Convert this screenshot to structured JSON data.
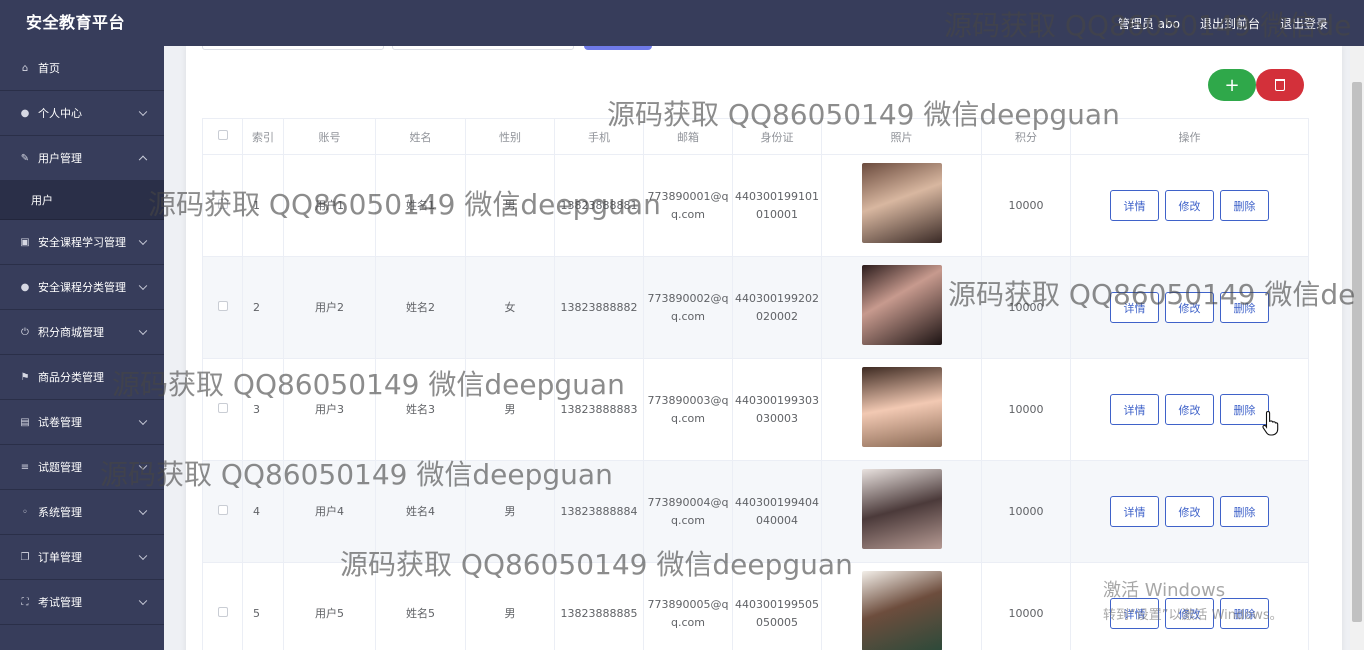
{
  "header": {
    "brand": "安全教育平台",
    "user_label": "管理员 abo",
    "frontend_link": "退出到前台",
    "logout_link": "退出登录"
  },
  "sidebar": {
    "items": [
      {
        "label": "首页",
        "icon": "home-icon"
      },
      {
        "label": "个人中心",
        "icon": "person-icon"
      },
      {
        "label": "用户管理",
        "icon": "edit-icon",
        "expanded": true,
        "children": [
          {
            "label": "用户"
          }
        ]
      },
      {
        "label": "安全课程学习管理",
        "icon": "folder-icon"
      },
      {
        "label": "安全课程分类管理",
        "icon": "person-icon"
      },
      {
        "label": "积分商城管理",
        "icon": "power-icon"
      },
      {
        "label": "商品分类管理",
        "icon": "flag-icon"
      },
      {
        "label": "试卷管理",
        "icon": "briefcase-icon"
      },
      {
        "label": "试题管理",
        "icon": "list-icon"
      },
      {
        "label": "系统管理",
        "icon": "bulb-icon"
      },
      {
        "label": "订单管理",
        "icon": "copy-icon"
      },
      {
        "label": "考试管理",
        "icon": "frame-icon"
      }
    ]
  },
  "toolbar": {
    "add_label": "+",
    "delete_icon": "trash-icon"
  },
  "table": {
    "headers": [
      "",
      "索引",
      "账号",
      "姓名",
      "性别",
      "手机",
      "邮箱",
      "身份证",
      "照片",
      "积分",
      "操作"
    ],
    "rows": [
      {
        "index": "1",
        "account": "用户1",
        "name": "姓名1",
        "gender": "男",
        "phone": "13823888881",
        "email": "773890001@qq.com",
        "id_card": "440300199101010001",
        "points": "10000"
      },
      {
        "index": "2",
        "account": "用户2",
        "name": "姓名2",
        "gender": "女",
        "phone": "13823888882",
        "email": "773890002@qq.com",
        "id_card": "440300199202020002",
        "points": "10000"
      },
      {
        "index": "3",
        "account": "用户3",
        "name": "姓名3",
        "gender": "男",
        "phone": "13823888883",
        "email": "773890003@qq.com",
        "id_card": "440300199303030003",
        "points": "10000"
      },
      {
        "index": "4",
        "account": "用户4",
        "name": "姓名4",
        "gender": "男",
        "phone": "13823888884",
        "email": "773890004@qq.com",
        "id_card": "440300199404040004",
        "points": "10000"
      },
      {
        "index": "5",
        "account": "用户5",
        "name": "姓名5",
        "gender": "男",
        "phone": "13823888885",
        "email": "773890005@qq.com",
        "id_card": "440300199505050005",
        "points": "10000"
      }
    ],
    "actions": {
      "detail": "详情",
      "edit": "修改",
      "delete": "删除"
    }
  },
  "watermark": {
    "text": "源码获取 QQ86050149 微信deepguan",
    "header_text": "源码获取 QQ86050149 微信de"
  },
  "activation": {
    "line1": "激活 Windows",
    "line2": "转到“设置”以激活 Windows。"
  },
  "colors": {
    "header_bg": "#373d5b",
    "sidebar_bg": "#373d5b",
    "submenu_bg": "#2a2f48",
    "add_button": "#2fa84a",
    "delete_button": "#d3303a",
    "action_border": "#3f62c9"
  }
}
